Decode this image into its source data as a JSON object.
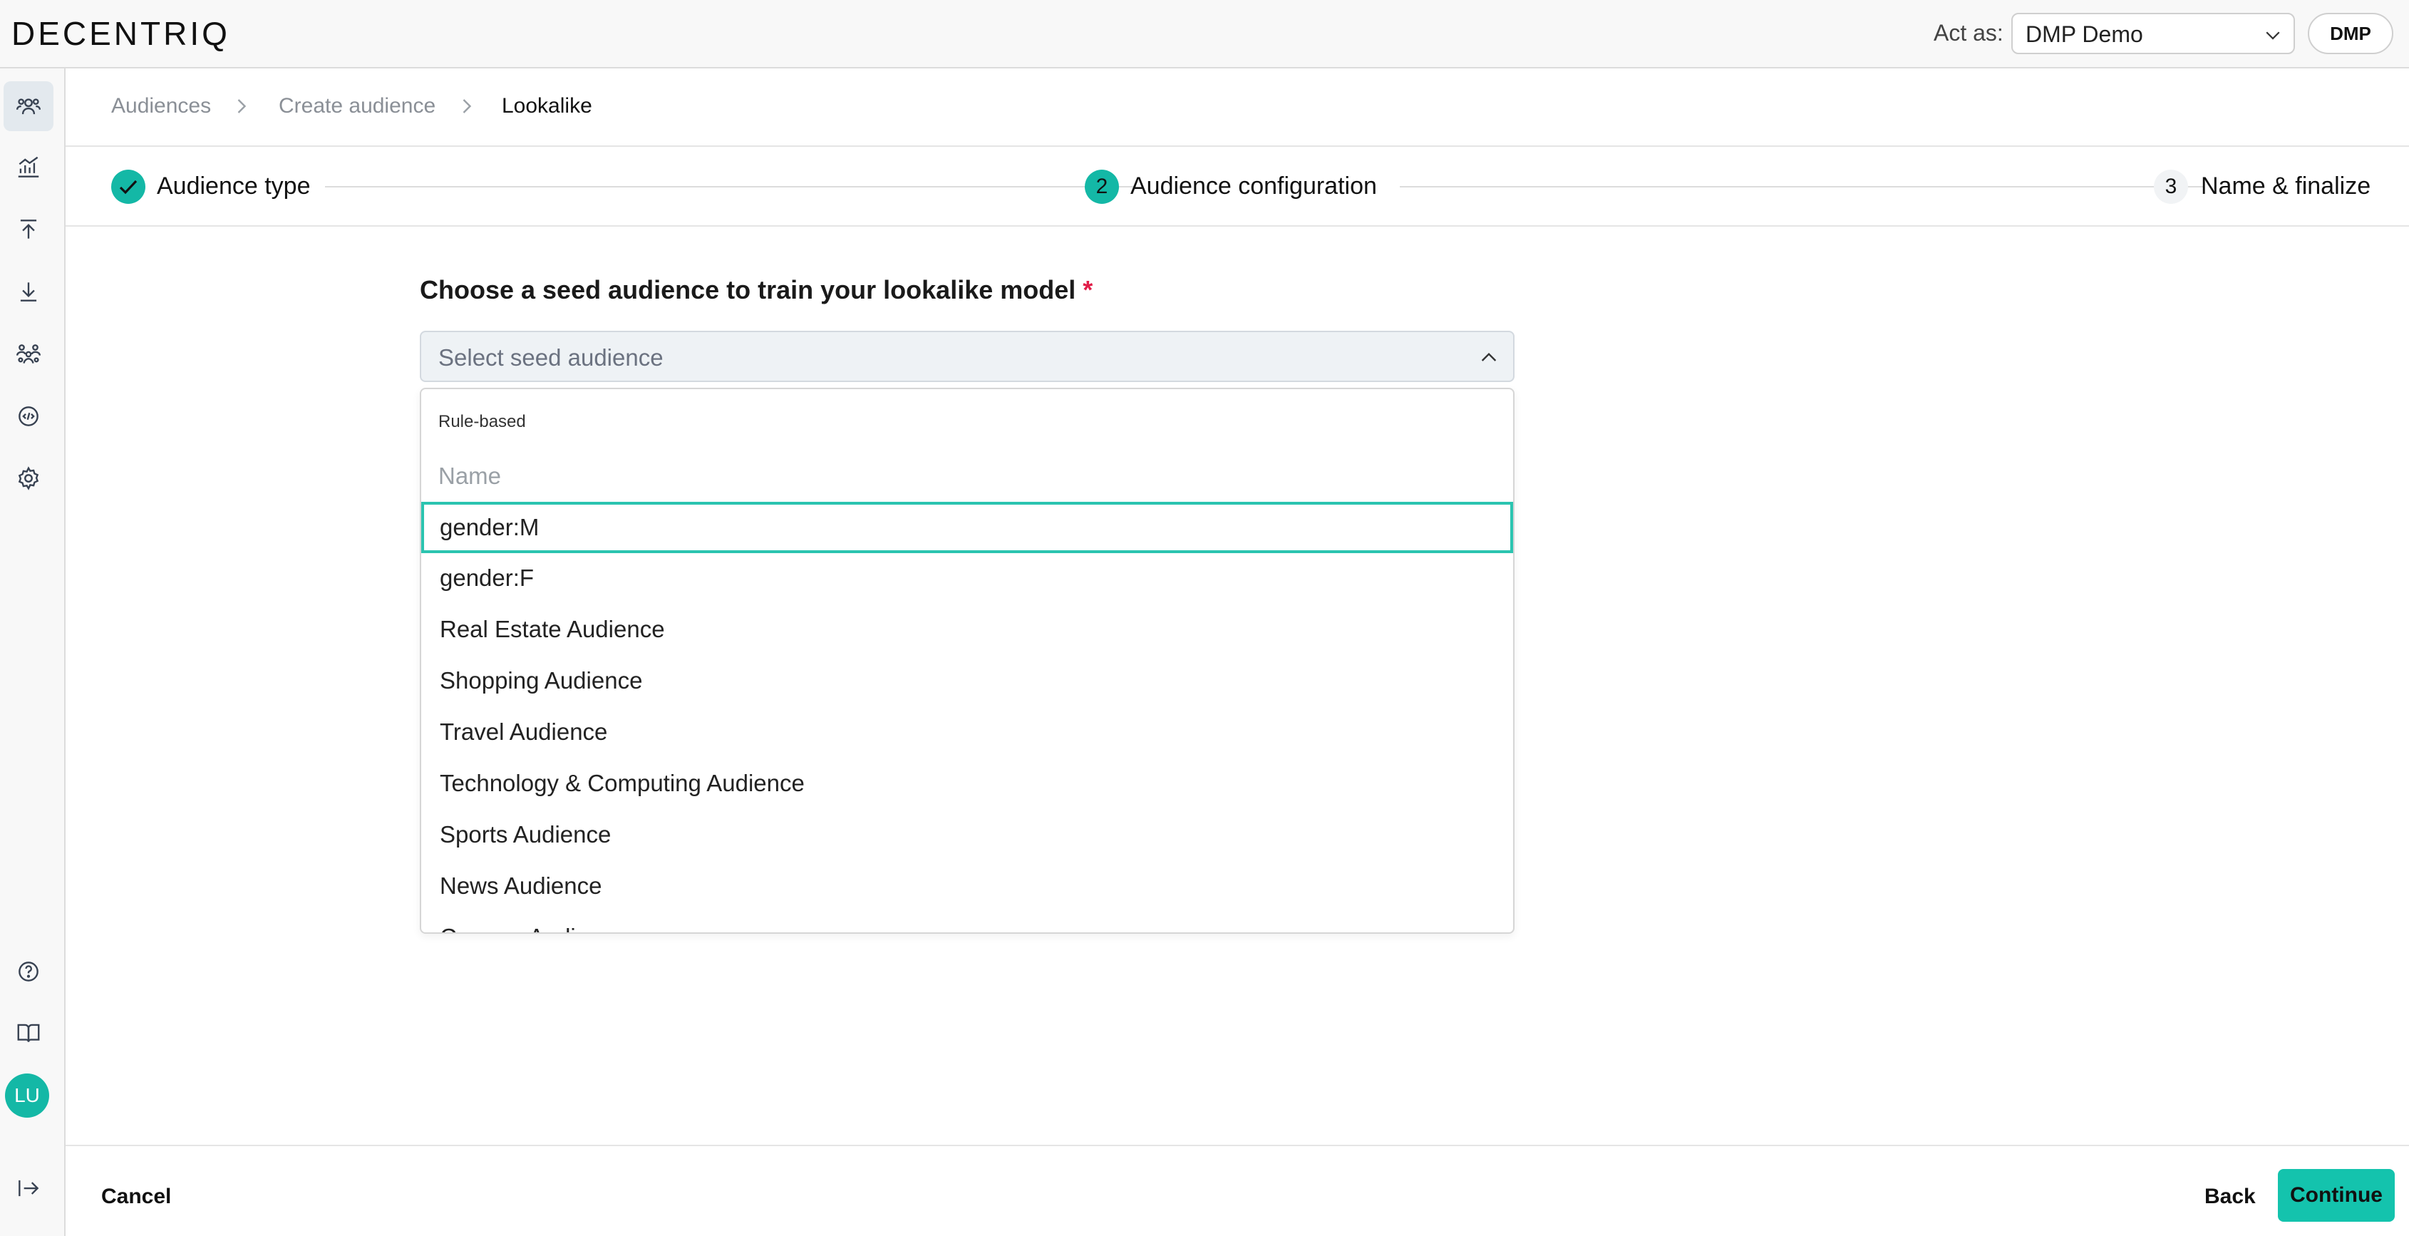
{
  "app": {
    "logo": "DECENTRIQ"
  },
  "header": {
    "act_as_label": "Act as:",
    "act_as_value": "DMP Demo",
    "org_badge": "DMP"
  },
  "sidebar": {
    "items": [
      {
        "icon": "audiences-icon"
      },
      {
        "icon": "insights-chart-icon"
      },
      {
        "icon": "upload-icon"
      },
      {
        "icon": "download-icon"
      },
      {
        "icon": "collaborators-icon"
      },
      {
        "icon": "developer-code-icon"
      },
      {
        "icon": "settings-gear-icon"
      }
    ],
    "bottom": [
      {
        "icon": "help-circle-icon"
      },
      {
        "icon": "documentation-book-icon"
      }
    ],
    "avatar_initials": "LU",
    "logout_icon": "logout-arrow-icon"
  },
  "breadcrumb": [
    "Audiences",
    "Create audience",
    "Lookalike"
  ],
  "stepper": {
    "steps": [
      {
        "number": "",
        "label": "Audience type",
        "state": "done"
      },
      {
        "number": "2",
        "label": "Audience configuration",
        "state": "active"
      },
      {
        "number": "3",
        "label": "Name & finalize",
        "state": "todo"
      }
    ]
  },
  "form": {
    "title": "Choose a seed audience to train your lookalike model",
    "required_mark": "*",
    "select_placeholder": "Select seed audience"
  },
  "dropdown": {
    "group_label": "Rule-based",
    "filter_placeholder": "Name",
    "options": [
      "gender:M",
      "gender:F",
      "Real Estate Audience",
      "Shopping Audience",
      "Travel Audience",
      "Technology & Computing Audience",
      "Sports Audience",
      "News Audience",
      "Careers Audience"
    ],
    "focused_index": 0
  },
  "footer": {
    "cancel": "Cancel",
    "back": "Back",
    "continue": "Continue"
  },
  "colors": {
    "accent": "#14c3ad",
    "required": "#e11d48",
    "focus_border": "#2bc4b0"
  }
}
